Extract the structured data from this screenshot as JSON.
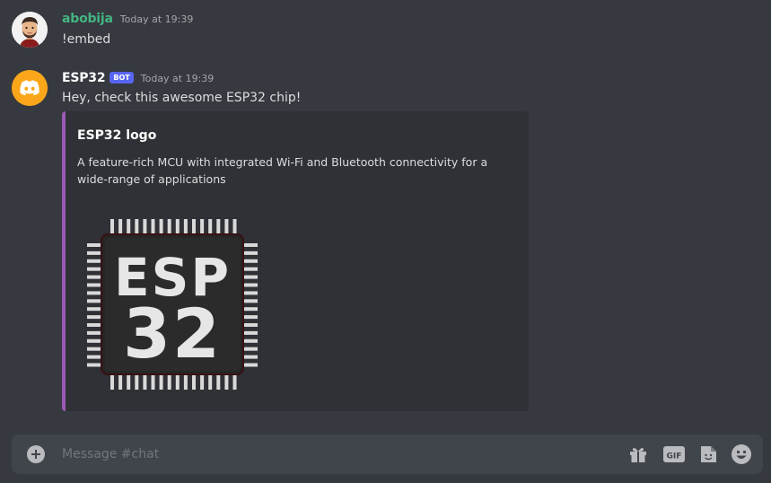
{
  "messages": [
    {
      "author": "abobija",
      "timestamp": "Today at 19:39",
      "content": "!embed",
      "author_color": "#43b581"
    },
    {
      "author": "ESP32",
      "bot_tag": "BOT",
      "timestamp": "Today at 19:39",
      "content": "Hey, check this awesome ESP32 chip!",
      "author_color": "#ffffff",
      "embed": {
        "title": "ESP32 logo",
        "description": "A feature-rich MCU with integrated Wi-Fi and Bluetooth connectivity for a wide-range of applications",
        "accent_color": "#9b59b6",
        "image_text_line1": "ESP",
        "image_text_line2": "32"
      }
    }
  ],
  "composer": {
    "placeholder": "Message #chat",
    "add_icon": "plus-circle-icon",
    "gift_icon": "gift-icon",
    "gif_label": "GIF",
    "sticker_icon": "sticker-icon",
    "emoji_icon": "emoji-icon"
  }
}
